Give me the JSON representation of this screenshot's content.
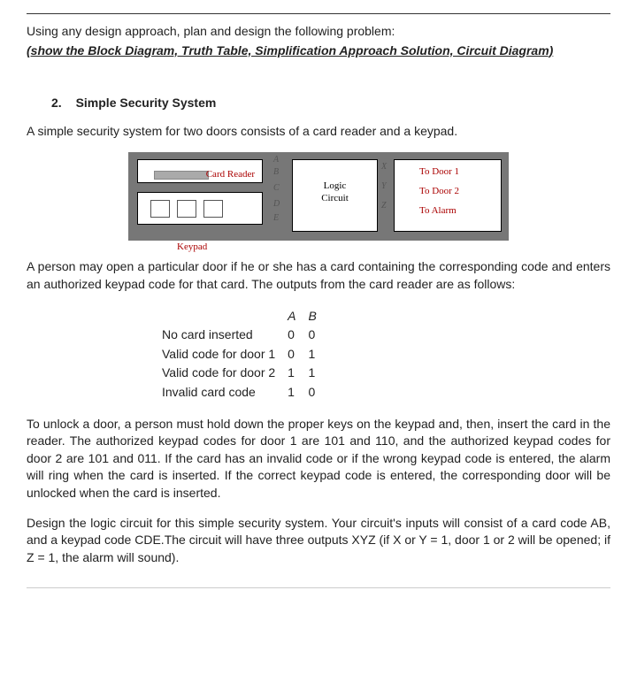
{
  "header": {
    "line1": "Using any design approach,  plan and design the following problem:",
    "line2": " (show the Block Diagram, Truth Table, Simplification Approach Solution, Circuit Diagram)"
  },
  "section": {
    "number": "2.",
    "title": "Simple Security System"
  },
  "intro_sentence": "A simple security system for two doors consists of a card reader and a keypad.",
  "diagram": {
    "card_reader": "Card Reader",
    "keypad": "Keypad",
    "logic1": "Logic",
    "logic2": "Circuit",
    "inputs": {
      "A": "A",
      "B": "B",
      "C": "C",
      "D": "D",
      "E": "E"
    },
    "outputs": {
      "X": "X",
      "Y": "Y",
      "Z": "Z"
    },
    "out_labels": {
      "o1": "To Door 1",
      "o2": "To Door 2",
      "o3": "To Alarm"
    }
  },
  "after_diagram": "A person may open a particular door if he or she has a card containing the corresponding code and enters an authorized keypad code for that card. The outputs from the card reader are as follows:",
  "code_table": {
    "head_A": "A",
    "head_B": "B",
    "rows": [
      {
        "label": "No card inserted",
        "A": "0",
        "B": "0"
      },
      {
        "label": "Valid code for door 1",
        "A": "0",
        "B": "1"
      },
      {
        "label": "Valid code for door 2",
        "A": "1",
        "B": "1"
      },
      {
        "label": "Invalid card code",
        "A": "1",
        "B": "0"
      }
    ]
  },
  "para_unlock": "To unlock a door, a person must hold down the proper keys on the keypad and, then, insert the card in the reader. The authorized keypad codes for door 1 are 101 and 110, and the authorized keypad codes for door 2 are 101 and 011. If the card has an invalid code or if the wrong keypad code is entered, the alarm will ring when the card is inserted. If the correct keypad code is entered, the corresponding door will be unlocked when the card is inserted.",
  "para_design": "Design the logic circuit for this simple security system. Your circuit's inputs will consist of a card code AB, and a keypad code CDE.The circuit will have three outputs XYZ (if X or Y = 1, door 1 or 2 will be opened; if Z = 1, the alarm will sound)."
}
